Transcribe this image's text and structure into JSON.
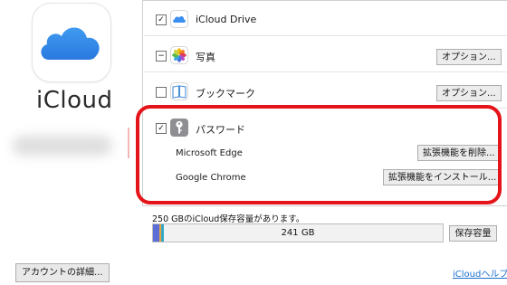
{
  "app": {
    "name": "iCloud"
  },
  "services": [
    {
      "id": "drive",
      "label": "iCloud Drive",
      "checked": true,
      "icon": "icloud-drive-icon"
    },
    {
      "id": "photos",
      "label": "写真",
      "checked": "indeterminate",
      "icon": "photos-icon",
      "options_label": "オプション..."
    },
    {
      "id": "bookmarks",
      "label": "ブックマーク",
      "checked": false,
      "icon": "bookmark-icon",
      "options_label": "オプション..."
    },
    {
      "id": "passwords",
      "label": "パスワード",
      "checked": true,
      "icon": "key-icon",
      "browsers": [
        {
          "name": "Microsoft Edge",
          "action": "拡張機能を削除..."
        },
        {
          "name": "Google Chrome",
          "action": "拡張機能をインストール..."
        }
      ]
    }
  ],
  "storage": {
    "summary": "250 GBのiCloud保存容量があります。",
    "free_label": "241 GB",
    "manage_label": "保存容量",
    "used_fraction": 0.036
  },
  "footer": {
    "account_details": "アカウントの詳細...",
    "help_link": "iCloudヘルプ"
  },
  "colors": {
    "highlight": "#e5141b",
    "segment_blue": "#5b6fd6",
    "segment_orange": "#f0a437",
    "segment_teal": "#37a9c8"
  }
}
